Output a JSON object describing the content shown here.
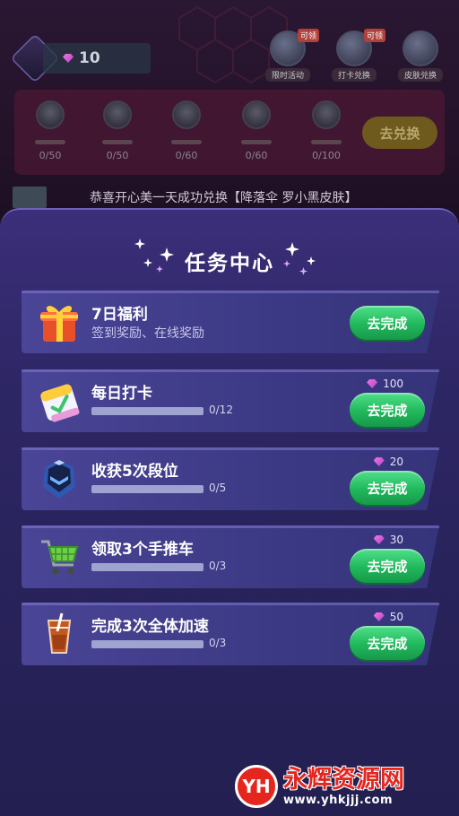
{
  "background": {
    "gem_count": "10",
    "top_buttons": [
      {
        "label": "限时活动",
        "tag": "可领"
      },
      {
        "label": "打卡兑换",
        "tag": "可领"
      },
      {
        "label": "皮肤兑换",
        "tag": ""
      }
    ],
    "ranks": [
      {
        "count": "0/50"
      },
      {
        "count": "0/50"
      },
      {
        "count": "0/60"
      },
      {
        "count": "0/60"
      },
      {
        "count": "0/100"
      }
    ],
    "exchange_label": "去兑换",
    "ticker": "恭喜开心美一天成功兑换【降落伞 罗小黑皮肤】"
  },
  "sheet": {
    "title": "任务中心",
    "tasks": [
      {
        "title": "7日福利",
        "subtitle": "签到奖励、在线奖励",
        "progress_text": "",
        "progress": 0,
        "reward": "",
        "button": "去完成",
        "icon": "gift-icon"
      },
      {
        "title": "每日打卡",
        "subtitle": "",
        "progress_text": "0/12",
        "progress": 0,
        "reward": "100",
        "button": "去完成",
        "icon": "calendar-check-icon"
      },
      {
        "title": "收获5次段位",
        "subtitle": "",
        "progress_text": "0/5",
        "progress": 0,
        "reward": "20",
        "button": "去完成",
        "icon": "rank-helmet-icon"
      },
      {
        "title": "领取3个手推车",
        "subtitle": "",
        "progress_text": "0/3",
        "progress": 0,
        "reward": "30",
        "button": "去完成",
        "icon": "shopping-cart-icon"
      },
      {
        "title": "完成3次全体加速",
        "subtitle": "",
        "progress_text": "0/3",
        "progress": 0,
        "reward": "50",
        "button": "去完成",
        "icon": "drink-cup-icon"
      }
    ]
  },
  "watermark": {
    "logo_text": "YH",
    "name": "永辉资源网",
    "url": "www.yhkjjj.com"
  },
  "colors": {
    "accent_green": "#21b85c",
    "sheet_purple": "#2d2664",
    "gem_pink": "#e07ad8"
  }
}
